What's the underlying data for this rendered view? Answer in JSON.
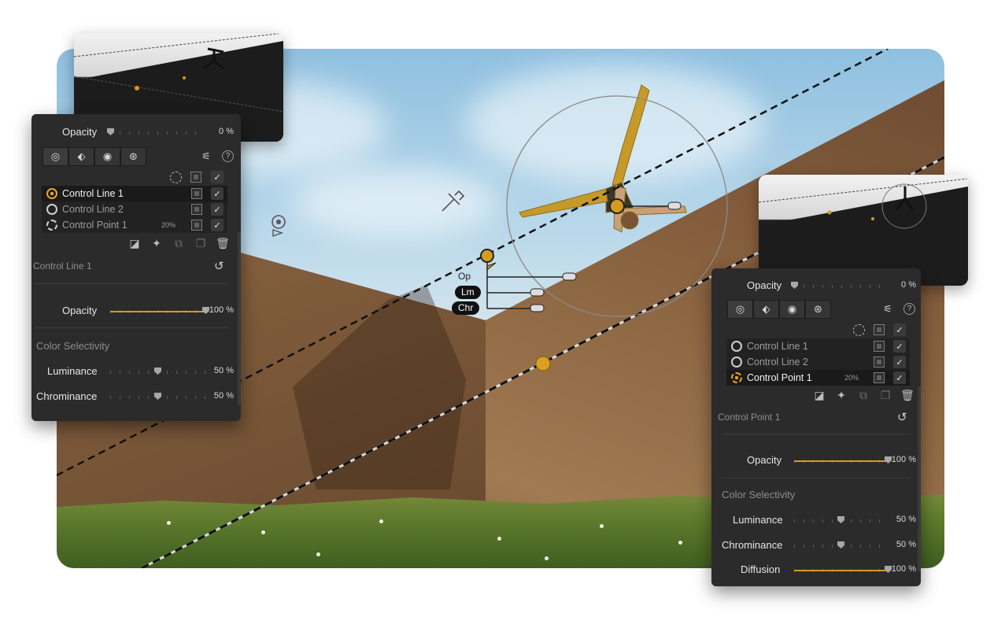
{
  "left_panel": {
    "top_opacity": {
      "label": "Opacity",
      "value": "0 %",
      "level": 0
    },
    "control_items": [
      {
        "label": "Control Line 1",
        "selected": true,
        "pct": ""
      },
      {
        "label": "Control Line 2",
        "selected": false,
        "pct": ""
      },
      {
        "label": "Control Point 1",
        "selected": false,
        "pct": "20%"
      }
    ],
    "section_title": "Control Line 1",
    "opacity": {
      "label": "Opacity",
      "value": "100 %",
      "level": 1.0
    },
    "color_selectivity": "Color Selectivity",
    "luminance": {
      "label": "Luminance",
      "value": "50 %",
      "level": 0.5
    },
    "chrominance": {
      "label": "Chrominance",
      "value": "50 %",
      "level": 0.5
    }
  },
  "right_panel": {
    "top_opacity": {
      "label": "Opacity",
      "value": "0 %",
      "level": 0
    },
    "control_items": [
      {
        "label": "Control Line 1",
        "selected": false,
        "pct": ""
      },
      {
        "label": "Control Line 2",
        "selected": false,
        "pct": ""
      },
      {
        "label": "Control Point 1",
        "selected": true,
        "pct": "20%"
      }
    ],
    "section_title": "Control Point 1",
    "opacity": {
      "label": "Opacity",
      "value": "100 %",
      "level": 1.0
    },
    "color_selectivity": "Color Selectivity",
    "luminance": {
      "label": "Luminance",
      "value": "50 %",
      "level": 0.5
    },
    "chrominance": {
      "label": "Chrominance",
      "value": "50 %",
      "level": 0.5
    },
    "diffusion": {
      "label": "Diffusion",
      "value": "100 %",
      "level": 1.0
    }
  },
  "canvas_labels": {
    "op": "Op",
    "lm": "Lm",
    "chr": "Chr"
  },
  "colors": {
    "accent": "#d49a1e",
    "panel": "#2b2b2b"
  },
  "icons": {
    "toolbar": [
      "control-point-icon",
      "color-picker-icon",
      "control-line-icon",
      "control-polygon-icon"
    ],
    "actions": [
      "mask-icon",
      "add-point-icon",
      "group-icon",
      "duplicate-icon",
      "delete-icon"
    ]
  }
}
